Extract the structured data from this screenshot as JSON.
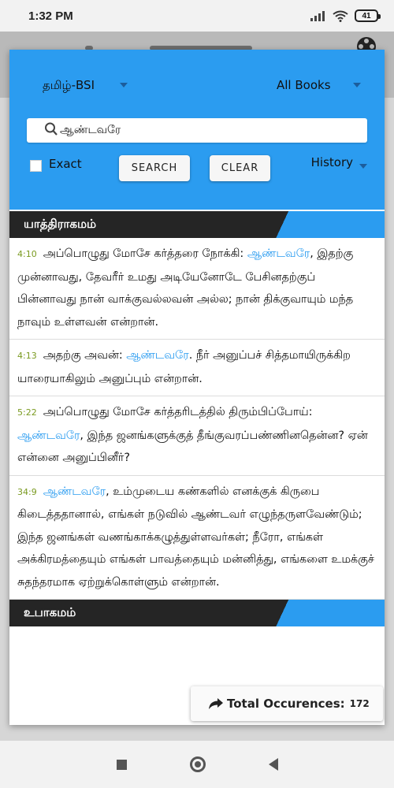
{
  "status_bar": {
    "time": "1:32 PM",
    "battery": "41"
  },
  "search_panel": {
    "version": "தமிழ்-BSI",
    "books": "All Books",
    "query": "ஆண்டவரே",
    "exact_label": "Exact",
    "search_label": "SEARCH",
    "clear_label": "CLEAR",
    "history_label": "History"
  },
  "sections": [
    {
      "title": "யாத்திராகமம்",
      "verses": [
        {
          "ref": "4:10",
          "before": "அப்பொழுது மோசே கர்த்தரை நோக்கி: ",
          "match": "ஆண்டவரே",
          "after": ", இதற்கு முன்னாவது, தேவரீர் உமது அடியேனோடே பேசினதற்குப் பின்னாவது நான் வாக்குவல்லவன் அல்ல; நான் திக்குவாயும் மந்த நாவும் உள்ளவன் என்றான்."
        },
        {
          "ref": "4:13",
          "before": "அதற்கு அவன்: ",
          "match": "ஆண்டவரே",
          "after": ". நீர் அனுப்பச் சித்தமாயிருக்கிற யாரையாகிலும் அனுப்பும் என்றான்."
        },
        {
          "ref": "5:22",
          "before": "அப்பொழுது மோசே கர்த்தரிடத்தில் திரும்பிப்போய்: ",
          "match": "ஆண்டவரே",
          "after": ", இந்த ஜனங்களுக்குத் தீங்குவரப்பண்ணினதென்ன? ஏன் என்னை அனுப்பினீர்?"
        },
        {
          "ref": "34:9",
          "before": "",
          "match": "ஆண்டவரே",
          "after": ", உம்முடைய கண்களில் எனக்குக் கிருபை கிடைத்ததானால், எங்கள் நடுவில் ஆண்டவர் எழுந்தருளவேண்டும்; இந்த ஜனங்கள் வணங்காக்கழுத்துள்ளவர்கள்; நீரோ, எங்கள் அக்கிரமத்தையும் எங்கள் பாவத்தையும் மன்னித்து, எங்களை உமக்குச் சுதந்தரமாக ஏற்றுக்கொள்ளும் என்றான்."
        }
      ]
    },
    {
      "title": "உபாகமம்",
      "verses": []
    }
  ],
  "total": {
    "label": "Total Occurences:",
    "count": "172"
  },
  "colors": {
    "accent": "#2b9cf0",
    "header_dark": "#252525",
    "ref": "#7a9a20"
  }
}
